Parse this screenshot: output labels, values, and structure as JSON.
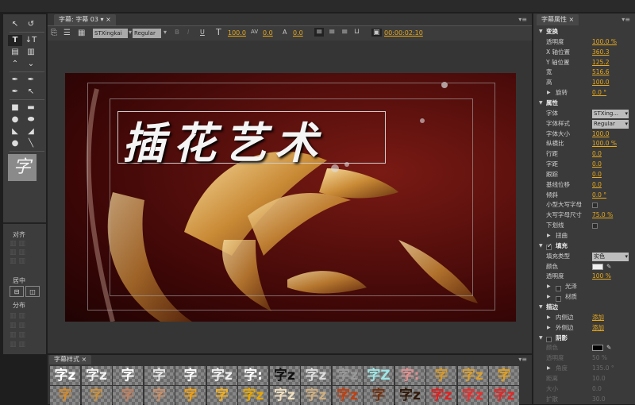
{
  "title_panel": {
    "tab": "字幕: 字幕 03",
    "font": "STXingkai",
    "style": "Regular",
    "font_size": "100.0",
    "kerning": "0.0",
    "leading": "0.0",
    "timecode": "00:00:02:10"
  },
  "canvas": {
    "title_text": "插花艺术",
    "bg_color": "#5a0e0e",
    "flower_color": "#d9a24a"
  },
  "tools": {
    "align_label": "对齐",
    "center_label": "居中",
    "distribute_label": "分布",
    "preview_glyph": "字"
  },
  "styles_panel": {
    "tab": "字幕样式",
    "thumbs": [
      {
        "g": "字z",
        "c": "#ffffff"
      },
      {
        "g": "字z",
        "c": "#f2f2f2"
      },
      {
        "g": "字",
        "c": "#ffffff"
      },
      {
        "g": "字",
        "c": "#e6e6e6"
      },
      {
        "g": "字",
        "c": "#ffffff"
      },
      {
        "g": "字z",
        "c": "#f0f0f0"
      },
      {
        "g": "字:",
        "c": "#ffffff"
      },
      {
        "g": "字z",
        "c": "#111111"
      },
      {
        "g": "字z",
        "c": "#dddddd"
      },
      {
        "g": "字z",
        "c": "#999999"
      },
      {
        "g": "字Z",
        "c": "#9fe6e6"
      },
      {
        "g": "字:",
        "c": "#e09090"
      },
      {
        "g": "字",
        "c": "#d79a2a"
      },
      {
        "g": "字z",
        "c": "#d9a030"
      },
      {
        "g": "字",
        "c": "#e0a020"
      },
      {
        "g": "字",
        "c": "#d08a30"
      },
      {
        "g": "字",
        "c": "#c89040"
      },
      {
        "g": "字",
        "c": "#c08060"
      },
      {
        "g": "字",
        "c": "#c8906a"
      },
      {
        "g": "字",
        "c": "#f0a010"
      },
      {
        "g": "字",
        "c": "#f2b020"
      },
      {
        "g": "字z",
        "c": "#e8a800"
      },
      {
        "g": "字z",
        "c": "#f0e0c0"
      },
      {
        "g": "字z",
        "c": "#d0b080"
      },
      {
        "g": "字z",
        "c": "#c04010"
      },
      {
        "g": "字",
        "c": "#703010"
      },
      {
        "g": "字z",
        "c": "#301808"
      },
      {
        "g": "字z",
        "c": "#e02020"
      },
      {
        "g": "字z",
        "c": "#e83030"
      },
      {
        "g": "字z",
        "c": "#e02828"
      }
    ]
  },
  "props": {
    "tab": "字幕属性",
    "transform": {
      "label": "变换",
      "opacity_l": "透明度",
      "opacity": "100.0 %",
      "x_l": "X 轴位置",
      "x": "360.3",
      "y_l": "Y 轴位置",
      "y": "125.2",
      "w_l": "宽",
      "w": "516.6",
      "h_l": "高",
      "h": "100.0",
      "rot_l": "旋转",
      "rot": "0.0 °"
    },
    "attrs": {
      "label": "属性",
      "font_l": "字体",
      "font": "STXing...",
      "style_l": "字体样式",
      "style": "Regular",
      "size_l": "字体大小",
      "size": "100.0",
      "aspect_l": "纵横比",
      "aspect": "100.0 %",
      "leading_l": "行距",
      "leading": "0.0",
      "kerning_l": "字距",
      "kerning": "0.0",
      "tracking_l": "跟踪",
      "tracking": "0.0",
      "baseline_l": "基线位移",
      "baseline": "0.0",
      "slant_l": "倾斜",
      "slant": "0.0 °",
      "smallcaps_l": "小型大写字母",
      "smallcaps_size_l": "大写字母尺寸",
      "smallcaps_size": "75.0 %",
      "underline_l": "下划线",
      "distort_l": "扭曲"
    },
    "fill": {
      "label": "填充",
      "type_l": "填充类型",
      "type": "实色",
      "color_l": "颜色",
      "color": "#f0f0f0",
      "opacity_l": "透明度",
      "opacity": "100 %",
      "sheen_l": "光泽",
      "texture_l": "材质"
    },
    "stroke": {
      "label": "描边",
      "inner_l": "内侧边",
      "inner": "添加",
      "outer_l": "外侧边",
      "outer": "添加"
    },
    "shadow": {
      "label": "阴影",
      "color_l": "颜色",
      "color": "#000000",
      "opacity_l": "透明度",
      "opacity": "50 %",
      "angle_l": "角度",
      "angle": "135.0 °",
      "dist_l": "距离",
      "dist": "10.0",
      "size_l": "大小",
      "size": "0.0",
      "spread_l": "扩散",
      "spread": "30.0"
    }
  }
}
